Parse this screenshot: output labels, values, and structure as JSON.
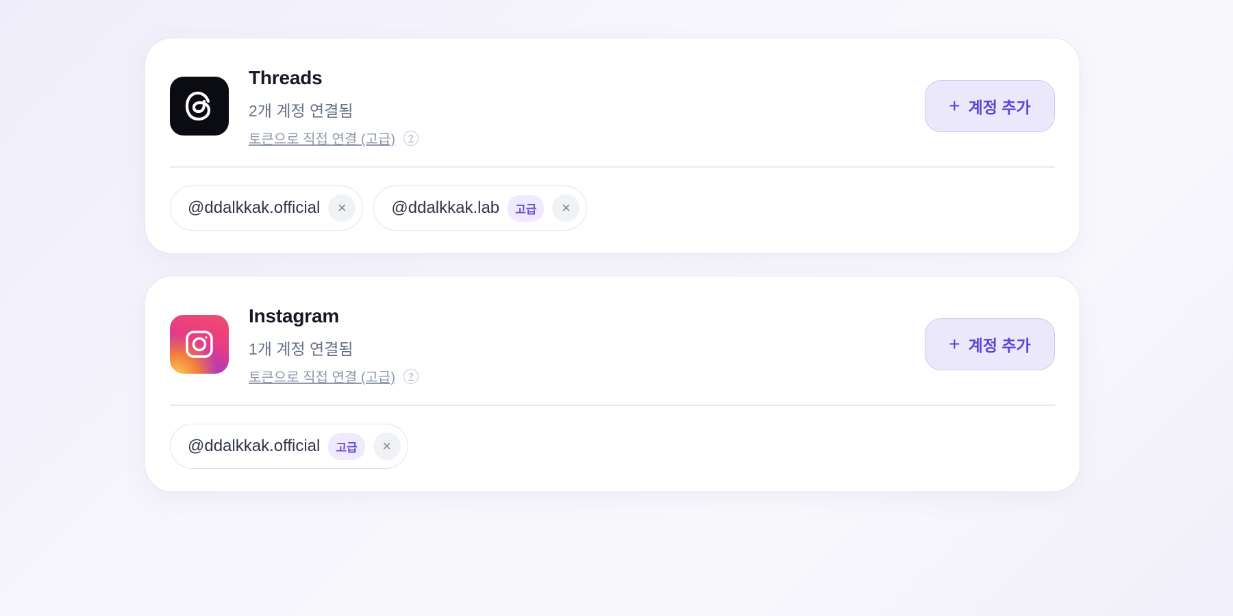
{
  "platforms": [
    {
      "name": "Threads",
      "subtitle": "2개 계정 연결됨",
      "token_link": "토큰으로 직접 연결 (고급)",
      "help_icon": "?",
      "add_button": {
        "icon": "+",
        "label": "계정 추가"
      },
      "accounts": [
        {
          "handle": "@ddalkkak.official",
          "badge": null,
          "remove_icon": "×"
        },
        {
          "handle": "@ddalkkak.lab",
          "badge": "고급",
          "remove_icon": "×"
        }
      ],
      "logo_icon": "threads-icon"
    },
    {
      "name": "Instagram",
      "subtitle": "1개 계정 연결됨",
      "token_link": "토큰으로 직접 연결 (고급)",
      "help_icon": "?",
      "add_button": {
        "icon": "+",
        "label": "계정 추가"
      },
      "accounts": [
        {
          "handle": "@ddalkkak.official",
          "badge": "고급",
          "remove_icon": "×"
        }
      ],
      "logo_icon": "instagram-icon"
    }
  ],
  "colors": {
    "accent": "#5b45d2",
    "accent_bg": "#ece8fc",
    "threads_logo_bg": "#0b0b12",
    "instagram_gradient": [
      "#f9d35a",
      "#f57c3a",
      "#e63c86",
      "#7c3cd6"
    ]
  }
}
